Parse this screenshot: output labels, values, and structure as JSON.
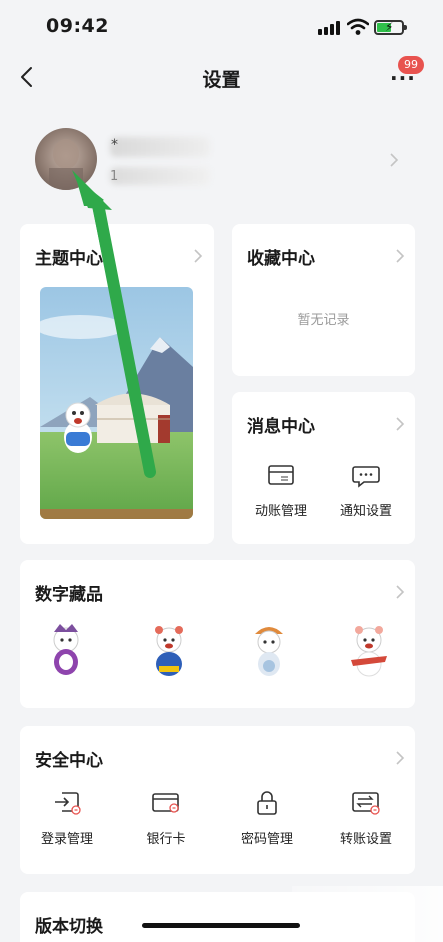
{
  "status_bar": {
    "time": "09:42"
  },
  "nav": {
    "title": "设置",
    "more_badge": "99"
  },
  "profile": {
    "name_visible": "*",
    "sub_visible": "1"
  },
  "cards": {
    "theme": {
      "title": "主题中心"
    },
    "favorites": {
      "title": "收藏中心",
      "empty_text": "暂无记录"
    },
    "messages": {
      "title": "消息中心",
      "items": [
        {
          "label": "动账管理",
          "icon": "transaction-icon"
        },
        {
          "label": "通知设置",
          "icon": "chat-bubble-icon"
        }
      ]
    },
    "digital": {
      "title": "数字藏品"
    },
    "security": {
      "title": "安全中心",
      "items": [
        {
          "label": "登录管理",
          "icon": "login-icon"
        },
        {
          "label": "银行卡",
          "icon": "bank-card-icon"
        },
        {
          "label": "密码管理",
          "icon": "lock-icon"
        },
        {
          "label": "转账设置",
          "icon": "transfer-icon"
        }
      ]
    },
    "version": {
      "title": "版本切换"
    }
  },
  "colors": {
    "badge": "#e8534f",
    "arrow": "#2fa94a",
    "background": "#f3f4f6"
  }
}
